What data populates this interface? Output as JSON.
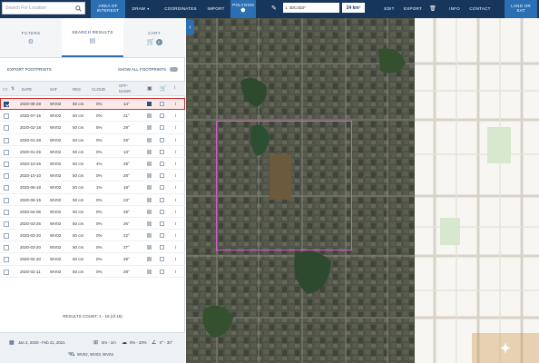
{
  "topbar": {
    "search_placeholder": "Search For Location",
    "tools": [
      {
        "id": "aoi",
        "line1": "AREA OF",
        "line2": "INTEREST"
      },
      {
        "id": "draw",
        "line1": "DRAW",
        "line2": ""
      },
      {
        "id": "coordinates",
        "line1": "COORDINATES",
        "line2": ""
      },
      {
        "id": "import",
        "line1": "IMPORT",
        "line2": ""
      },
      {
        "id": "polygon",
        "line1": "POLYGON",
        "line2": ""
      }
    ],
    "coordinates_value": "1, 3DC4D2*",
    "area_value": "24 km²",
    "right_tools": [
      {
        "id": "edit",
        "label": "EDIT"
      },
      {
        "id": "export",
        "label": "EXPORT"
      },
      {
        "id": "info",
        "label": "INFO"
      },
      {
        "id": "contact",
        "label": "CONTACT"
      },
      {
        "id": "land",
        "line1": "LAND OR",
        "line2": "SAT"
      }
    ]
  },
  "tabs": {
    "filters": "FILTERS",
    "search_results": "SEARCH RESULTS",
    "cart": "CART",
    "cart_count": "2"
  },
  "footprints": {
    "export_label": "EXPORT FOOTPRINTS",
    "show_all_label": "SHOW ALL FOOTPRINTS"
  },
  "table": {
    "headers": {
      "date": "DATE",
      "sat": "SAT",
      "res": "RES",
      "cloud": "CLOUD",
      "offnadir_1": "OFF-",
      "offnadir_2": "NADIR"
    },
    "rows": [
      {
        "date": "2020-08-28",
        "sat": "WV02",
        "res": "50 cm",
        "cloud": "0%",
        "nadir": "14°",
        "selected": true
      },
      {
        "date": "2020-07-15",
        "sat": "WV02",
        "res": "50 cm",
        "cloud": "0%",
        "nadir": "21°",
        "selected": false
      },
      {
        "date": "2020-02-18",
        "sat": "WV02",
        "res": "50 cm",
        "cloud": "5%",
        "nadir": "29°",
        "selected": false
      },
      {
        "date": "2020-01-28",
        "sat": "WV02",
        "res": "50 cm",
        "cloud": "0%",
        "nadir": "28°",
        "selected": false
      },
      {
        "date": "2020-01-25",
        "sat": "WV02",
        "res": "50 cm",
        "cloud": "0%",
        "nadir": "13°",
        "selected": false
      },
      {
        "date": "2020-10-26",
        "sat": "WV02",
        "res": "50 cm",
        "cloud": "4%",
        "nadir": "29°",
        "selected": false
      },
      {
        "date": "2020-10-10",
        "sat": "WV02",
        "res": "50 cm",
        "cloud": "0%",
        "nadir": "28°",
        "selected": false
      },
      {
        "date": "2020-06-18",
        "sat": "WV02",
        "res": "50 cm",
        "cloud": "1%",
        "nadir": "18°",
        "selected": false
      },
      {
        "date": "2020-06-15",
        "sat": "WV02",
        "res": "50 cm",
        "cloud": "0%",
        "nadir": "23°",
        "selected": false
      },
      {
        "date": "2020-04-06",
        "sat": "WV02",
        "res": "50 cm",
        "cloud": "0%",
        "nadir": "29°",
        "selected": false
      },
      {
        "date": "2020-03-26",
        "sat": "WV02",
        "res": "50 cm",
        "cloud": "0%",
        "nadir": "26°",
        "selected": false
      },
      {
        "date": "2020-03-20",
        "sat": "WV02",
        "res": "50 cm",
        "cloud": "0%",
        "nadir": "22°",
        "selected": false
      },
      {
        "date": "2020-03-20",
        "sat": "WV02",
        "res": "50 cm",
        "cloud": "0%",
        "nadir": "27°",
        "selected": false
      },
      {
        "date": "2020-02-20",
        "sat": "WV02",
        "res": "50 cm",
        "cloud": "0%",
        "nadir": "29°",
        "selected": false
      },
      {
        "date": "2020-02-11",
        "sat": "WV02",
        "res": "50 cm",
        "cloud": "0%",
        "nadir": "28°",
        "selected": false
      }
    ]
  },
  "results_count": "RESULTS COUNT:  1 - 16 (of 16)",
  "footer": {
    "date_range": "Jan 2, 2020 - Feb 21, 2021",
    "resolution": "0m - 1m",
    "cloud": "0% - 20%",
    "nadir": "0° - 30°",
    "satellites": "WV02, WV03, WV04"
  },
  "colors": {
    "topbar": "#17365c",
    "accent": "#2b6fb3",
    "aoi": "#d55bd0",
    "selected_row": "#d03030"
  }
}
